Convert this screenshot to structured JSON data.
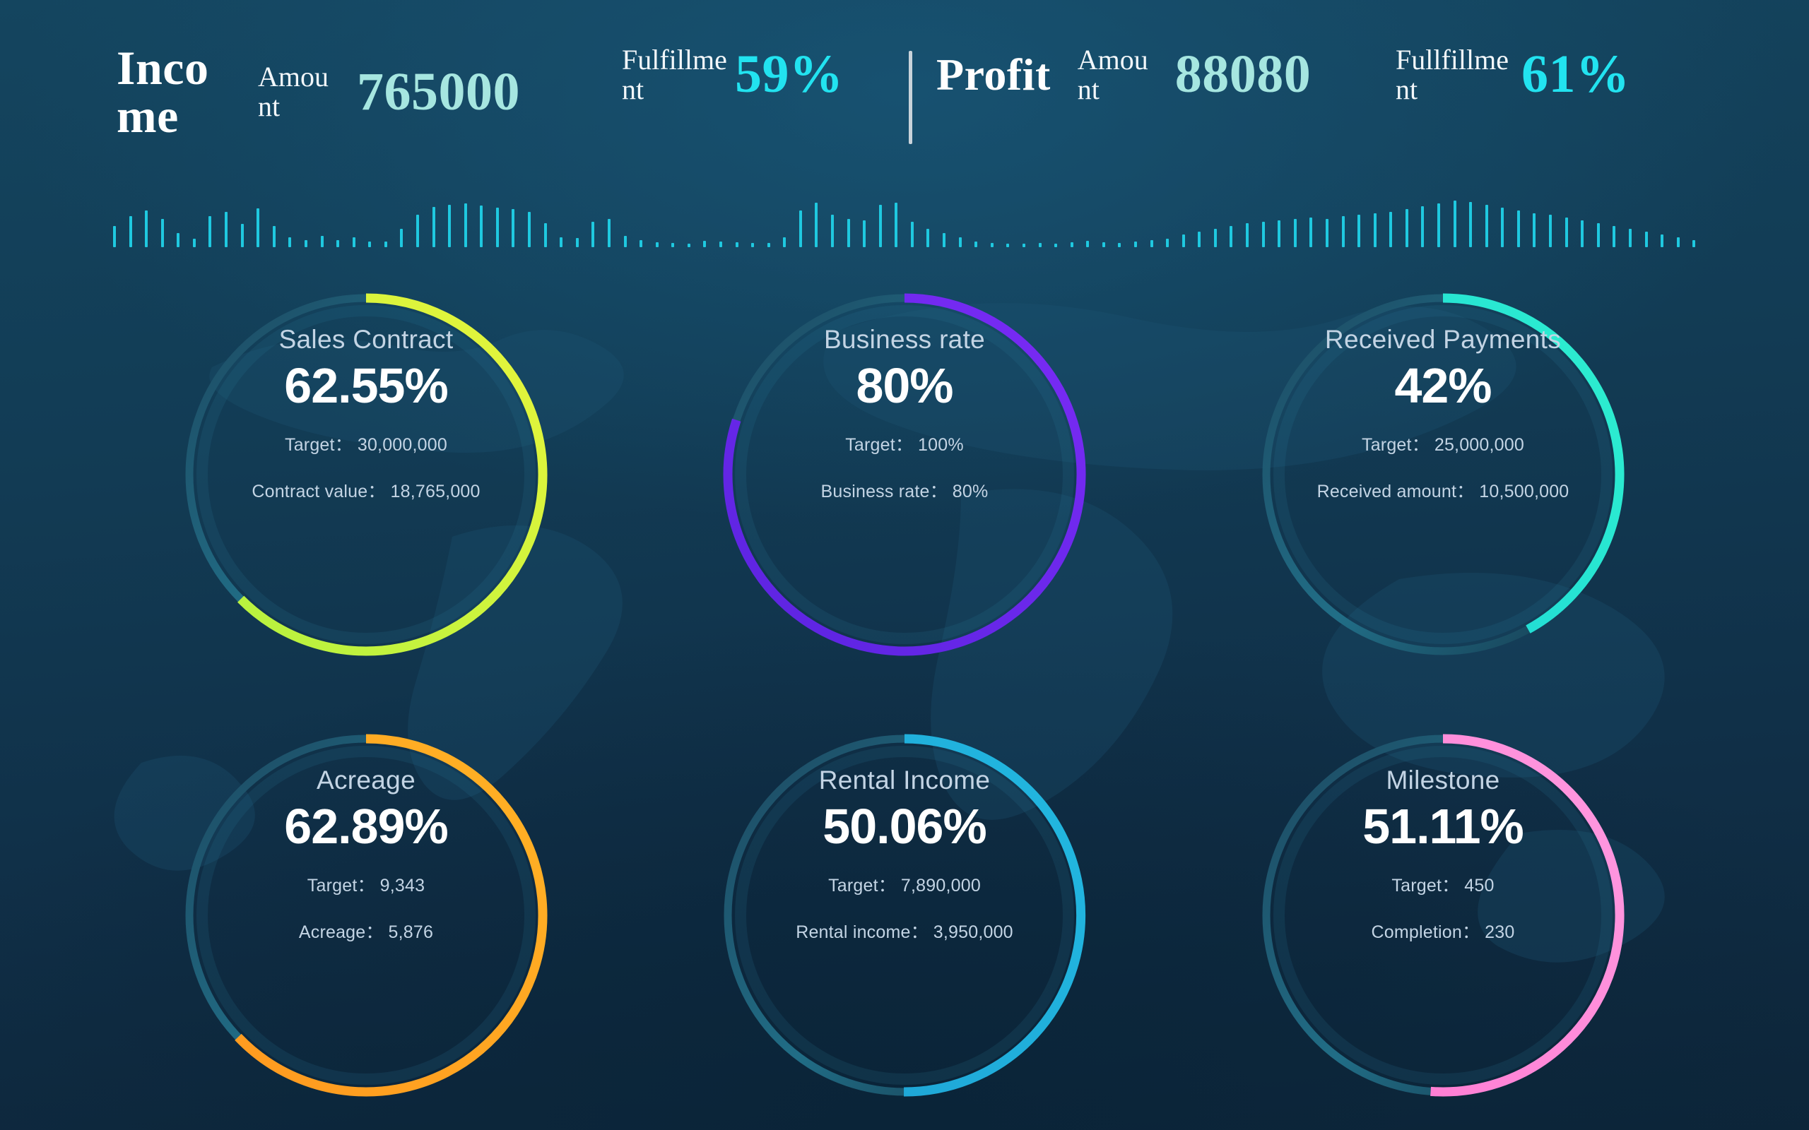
{
  "header": {
    "divider": true,
    "groups": [
      {
        "label": "Income",
        "label_lines": [
          "Inco",
          "me"
        ],
        "sub": "Amount",
        "sub_lines": [
          "Amou",
          "nt"
        ],
        "value": "765000",
        "value_kind": "number"
      },
      {
        "label": "",
        "label_lines": [],
        "sub": "Fulfillment",
        "sub_lines": [
          "Fulfillme",
          "nt"
        ],
        "value": "59%",
        "value_kind": "percent"
      },
      {
        "label": "Profit",
        "label_lines": [
          "Profit"
        ],
        "sub": "Amount",
        "sub_lines": [
          "Amou",
          "nt"
        ],
        "value": "88080",
        "value_kind": "number"
      },
      {
        "label": "",
        "label_lines": [],
        "sub": "Fullfillment",
        "sub_lines": [
          "Fullfillme",
          "nt"
        ],
        "value": "61%",
        "value_kind": "percent"
      }
    ]
  },
  "waveform": {
    "color": "#1fc9e0",
    "bars": [
      30,
      44,
      52,
      40,
      20,
      12,
      44,
      50,
      33,
      55,
      30,
      14,
      10,
      16,
      10,
      14,
      8,
      8,
      26,
      46,
      57,
      60,
      62,
      59,
      56,
      54,
      50,
      34,
      14,
      13,
      36,
      40,
      16,
      10,
      7,
      6,
      5,
      9,
      8,
      7,
      6,
      6,
      14,
      52,
      63,
      46,
      40,
      38,
      60,
      63,
      36,
      26,
      20,
      14,
      8,
      6,
      5,
      5,
      6,
      5,
      7,
      9,
      7,
      6,
      8,
      10,
      12,
      18,
      22,
      26,
      30,
      34,
      36,
      38,
      40,
      42,
      40,
      44,
      46,
      48,
      50,
      54,
      58,
      62,
      66,
      64,
      60,
      56,
      52,
      48,
      46,
      42,
      38,
      34,
      30,
      26,
      22,
      18,
      14,
      10
    ]
  },
  "chart_data": {
    "type": "gauge",
    "title": "Business performance gauges",
    "gauges": [
      {
        "title": "Sales Contract",
        "percent_label": "62.55%",
        "percent": 62.55,
        "color_from": "#e8f53b",
        "color_to": "#b6f23f",
        "track": "#1b4a63",
        "meta": [
          {
            "label": "Target",
            "sep": "：",
            "value": "30,000,000"
          },
          {
            "label": "Contract value",
            "sep": "：",
            "value": "18,765,000"
          }
        ]
      },
      {
        "title": "Business rate",
        "percent_label": "80%",
        "percent": 80,
        "color_from": "#7a2bf5",
        "color_to": "#5b24e0",
        "track": "#1b4a63",
        "meta": [
          {
            "label": "Target",
            "sep": "：",
            "value": "100%"
          },
          {
            "label": "Business rate",
            "sep": "：",
            "value": "80%"
          }
        ]
      },
      {
        "title": "Received Payments",
        "percent_label": "42%",
        "percent": 42,
        "color_from": "#2ff0cf",
        "color_to": "#1fd9d6",
        "track": "#1b4a63",
        "meta": [
          {
            "label": "Target",
            "sep": "：",
            "value": "25,000,000"
          },
          {
            "label": "Received amount",
            "sep": "：",
            "value": "10,500,000"
          }
        ]
      },
      {
        "title": "Acreage",
        "percent_label": "62.89%",
        "percent": 62.89,
        "color_from": "#ffb225",
        "color_to": "#ff9a1f",
        "track": "#1b4a63",
        "meta": [
          {
            "label": "Target",
            "sep": "：",
            "value": "9,343"
          },
          {
            "label": "Acreage",
            "sep": "：",
            "value": "5,876"
          }
        ]
      },
      {
        "title": "Rental Income",
        "percent_label": "50.06%",
        "percent": 50.06,
        "color_from": "#22b8e0",
        "color_to": "#1fa8d8",
        "track": "#1b4a63",
        "meta": [
          {
            "label": "Target",
            "sep": "：",
            "value": "7,890,000"
          },
          {
            "label": "Rental income",
            "sep": "：",
            "value": "3,950,000"
          }
        ]
      },
      {
        "title": "Milestone",
        "percent_label": "51.11%",
        "percent": 51.11,
        "color_from": "#ff9ae0",
        "color_to": "#ff7fd4",
        "track": "#1b4a63",
        "meta": [
          {
            "label": "Target",
            "sep": "：",
            "value": "450"
          },
          {
            "label": "Completion",
            "sep": "：",
            "value": "230"
          }
        ]
      }
    ]
  },
  "theme": {
    "bg_top": "#14455f",
    "bg_bottom": "#0d2539",
    "accent_cyan": "#22e3f0",
    "value_teal": "#a6e6e0",
    "label_white": "#ffffff",
    "meta_grey": "#c3d4e4"
  }
}
